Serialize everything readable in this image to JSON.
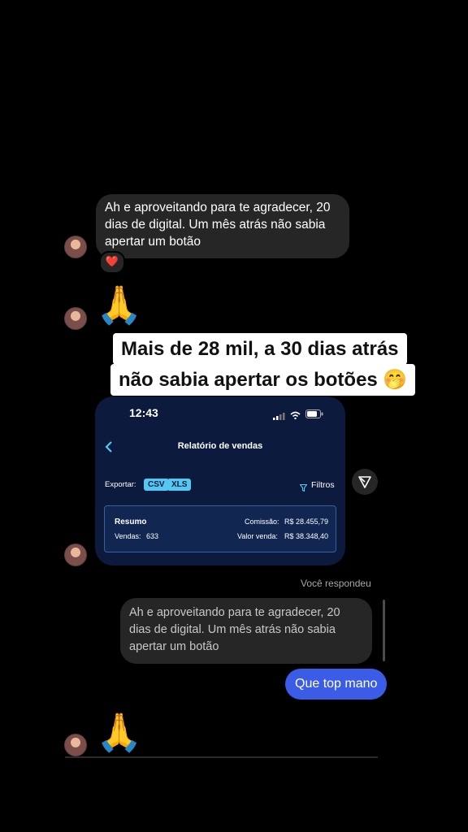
{
  "msg1": {
    "text": "Ah e aproveitando para te agradecer, 20 dias de digital. Um mês atrás não sabia apertar um botão",
    "reaction": "❤️"
  },
  "pray_emoji": "🙏",
  "banner": {
    "line1": "Mais de 28 mil, a 30 dias atrás",
    "line2": "não sabia apertar os botões 🤭"
  },
  "phone": {
    "time": "12:43",
    "title": "Relatório de vendas",
    "export_label": "Exportar:",
    "export_formats": [
      "CSV",
      "XLS"
    ],
    "filters_label": "Filtros",
    "summary": {
      "heading": "Resumo",
      "sales_label": "Vendas:",
      "sales_value": "633",
      "commission_label": "Comissão:",
      "commission_value": "R$ 28.455,79",
      "sale_value_label": "Valor venda:",
      "sale_value_value": "R$ 38.348,40"
    }
  },
  "replied_label": "Você respondeu",
  "quoted_text": "Ah e aproveitando para te agradecer, 20 dias de digital. Um mês atrás não sabia apertar um botão",
  "reply_text": "Que top mano",
  "colors": {
    "background": "#000000",
    "bubble_gray": "#262626",
    "bubble_blue": "#3b5ce6",
    "phone_bg": "#0c1a3d",
    "accent_cyan": "#53c8f3"
  }
}
